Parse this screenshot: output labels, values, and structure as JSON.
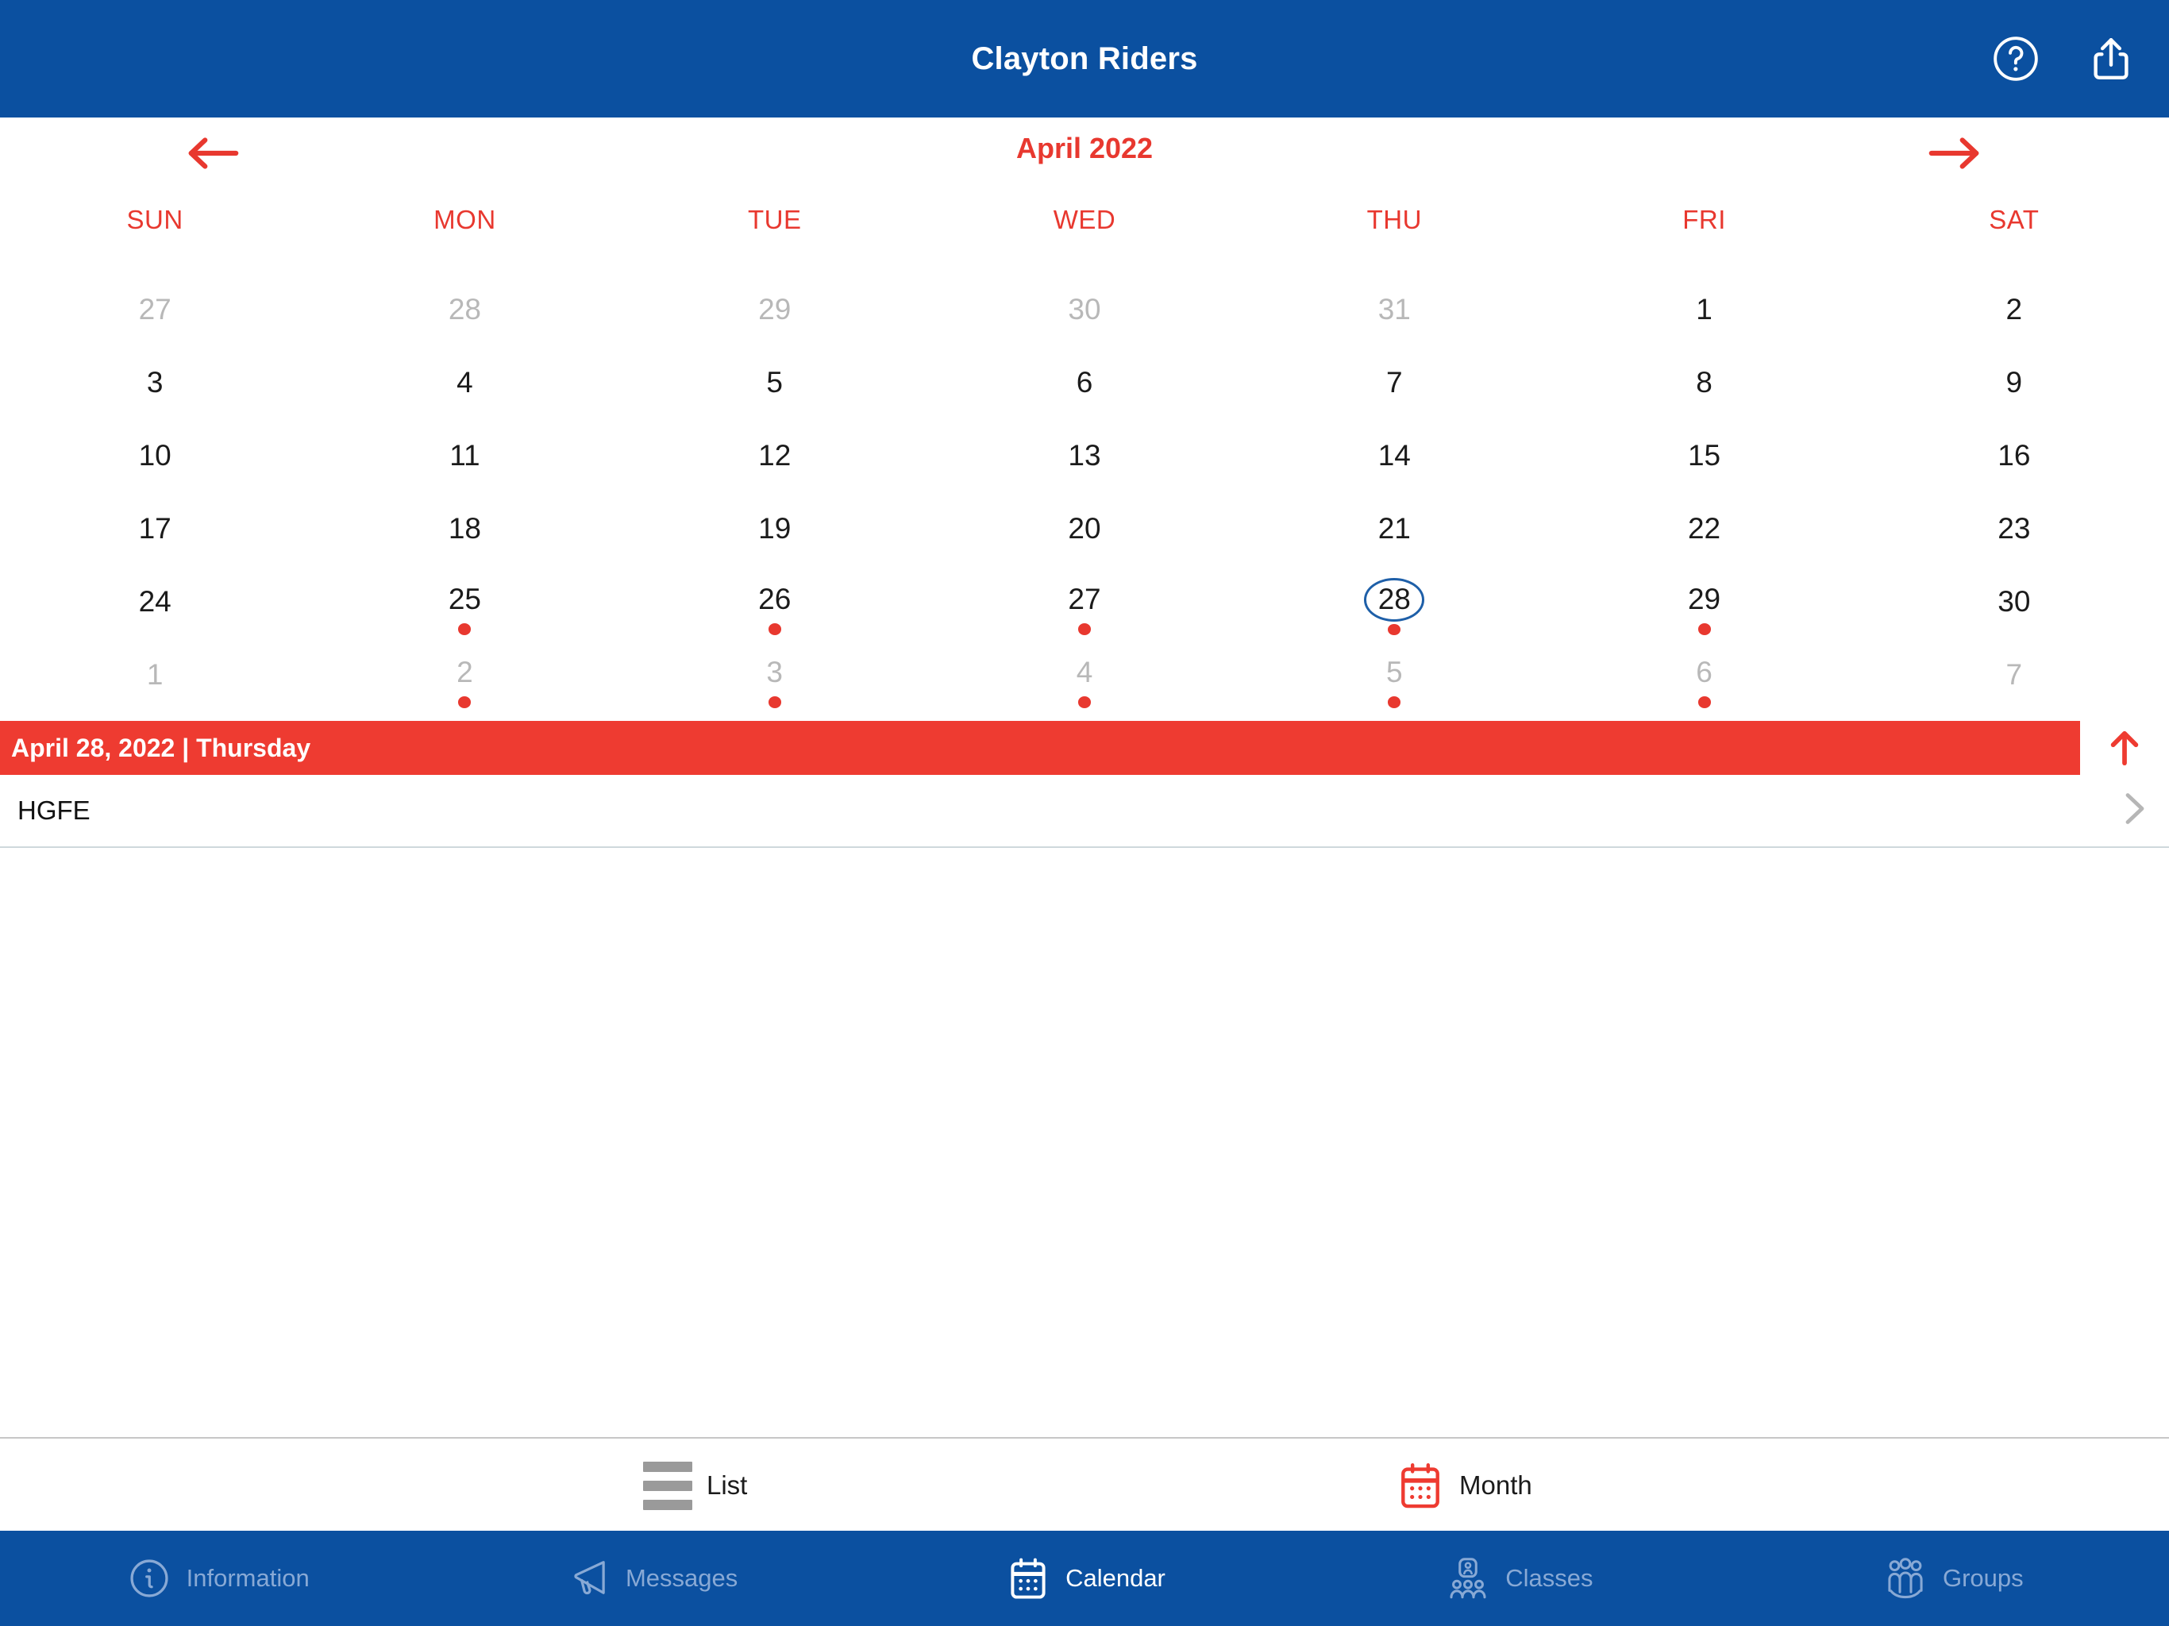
{
  "header": {
    "title": "Clayton Riders",
    "help_icon": "question-circle-icon",
    "share_icon": "share-icon",
    "background_color": "#0B50A0"
  },
  "calendar": {
    "month_label": "April 2022",
    "prev_label": "←",
    "next_label": "→",
    "accent_color": "#E8382F",
    "selected_ring_color": "#1e5fa8",
    "weekdays": [
      "SUN",
      "MON",
      "TUE",
      "WED",
      "THU",
      "FRI",
      "SAT"
    ],
    "weeks": [
      [
        {
          "day": "27",
          "muted": true,
          "dot": false,
          "selected": false
        },
        {
          "day": "28",
          "muted": true,
          "dot": false,
          "selected": false
        },
        {
          "day": "29",
          "muted": true,
          "dot": false,
          "selected": false
        },
        {
          "day": "30",
          "muted": true,
          "dot": false,
          "selected": false
        },
        {
          "day": "31",
          "muted": true,
          "dot": false,
          "selected": false
        },
        {
          "day": "1",
          "muted": false,
          "dot": false,
          "selected": false
        },
        {
          "day": "2",
          "muted": false,
          "dot": false,
          "selected": false
        }
      ],
      [
        {
          "day": "3",
          "muted": false,
          "dot": false,
          "selected": false
        },
        {
          "day": "4",
          "muted": false,
          "dot": false,
          "selected": false
        },
        {
          "day": "5",
          "muted": false,
          "dot": false,
          "selected": false
        },
        {
          "day": "6",
          "muted": false,
          "dot": false,
          "selected": false
        },
        {
          "day": "7",
          "muted": false,
          "dot": false,
          "selected": false
        },
        {
          "day": "8",
          "muted": false,
          "dot": false,
          "selected": false
        },
        {
          "day": "9",
          "muted": false,
          "dot": false,
          "selected": false
        }
      ],
      [
        {
          "day": "10",
          "muted": false,
          "dot": false,
          "selected": false
        },
        {
          "day": "11",
          "muted": false,
          "dot": false,
          "selected": false
        },
        {
          "day": "12",
          "muted": false,
          "dot": false,
          "selected": false
        },
        {
          "day": "13",
          "muted": false,
          "dot": false,
          "selected": false
        },
        {
          "day": "14",
          "muted": false,
          "dot": false,
          "selected": false
        },
        {
          "day": "15",
          "muted": false,
          "dot": false,
          "selected": false
        },
        {
          "day": "16",
          "muted": false,
          "dot": false,
          "selected": false
        }
      ],
      [
        {
          "day": "17",
          "muted": false,
          "dot": false,
          "selected": false
        },
        {
          "day": "18",
          "muted": false,
          "dot": false,
          "selected": false
        },
        {
          "day": "19",
          "muted": false,
          "dot": false,
          "selected": false
        },
        {
          "day": "20",
          "muted": false,
          "dot": false,
          "selected": false
        },
        {
          "day": "21",
          "muted": false,
          "dot": false,
          "selected": false
        },
        {
          "day": "22",
          "muted": false,
          "dot": false,
          "selected": false
        },
        {
          "day": "23",
          "muted": false,
          "dot": false,
          "selected": false
        }
      ],
      [
        {
          "day": "24",
          "muted": false,
          "dot": false,
          "selected": false
        },
        {
          "day": "25",
          "muted": false,
          "dot": true,
          "selected": false
        },
        {
          "day": "26",
          "muted": false,
          "dot": true,
          "selected": false
        },
        {
          "day": "27",
          "muted": false,
          "dot": true,
          "selected": false
        },
        {
          "day": "28",
          "muted": false,
          "dot": true,
          "selected": true
        },
        {
          "day": "29",
          "muted": false,
          "dot": true,
          "selected": false
        },
        {
          "day": "30",
          "muted": false,
          "dot": false,
          "selected": false
        }
      ],
      [
        {
          "day": "1",
          "muted": true,
          "dot": false,
          "selected": false
        },
        {
          "day": "2",
          "muted": true,
          "dot": true,
          "selected": false
        },
        {
          "day": "3",
          "muted": true,
          "dot": true,
          "selected": false
        },
        {
          "day": "4",
          "muted": true,
          "dot": true,
          "selected": false
        },
        {
          "day": "5",
          "muted": true,
          "dot": true,
          "selected": false
        },
        {
          "day": "6",
          "muted": true,
          "dot": true,
          "selected": false
        },
        {
          "day": "7",
          "muted": true,
          "dot": false,
          "selected": false
        }
      ]
    ]
  },
  "day_banner": {
    "text": "April 28, 2022 | Thursday",
    "background_color": "#EE3B31",
    "collapse_icon": "arrow-up-icon"
  },
  "events": [
    {
      "title": "HGFE",
      "chevron": "chevron-right-icon"
    }
  ],
  "view_switch": {
    "items": [
      {
        "label": "List",
        "icon": "list-icon",
        "active": false
      },
      {
        "label": "Month",
        "icon": "calendar-icon",
        "active": true
      }
    ]
  },
  "tabbar": {
    "background_color": "#0B50A0",
    "inactive_color": "#88A9D5",
    "active_color": "#FFFFFF",
    "items": [
      {
        "label": "Information",
        "icon": "info-circle-icon",
        "active": false
      },
      {
        "label": "Messages",
        "icon": "megaphone-icon",
        "active": false
      },
      {
        "label": "Calendar",
        "icon": "calendar-icon",
        "active": true
      },
      {
        "label": "Classes",
        "icon": "classes-icon",
        "active": false
      },
      {
        "label": "Groups",
        "icon": "groups-icon",
        "active": false
      }
    ]
  }
}
